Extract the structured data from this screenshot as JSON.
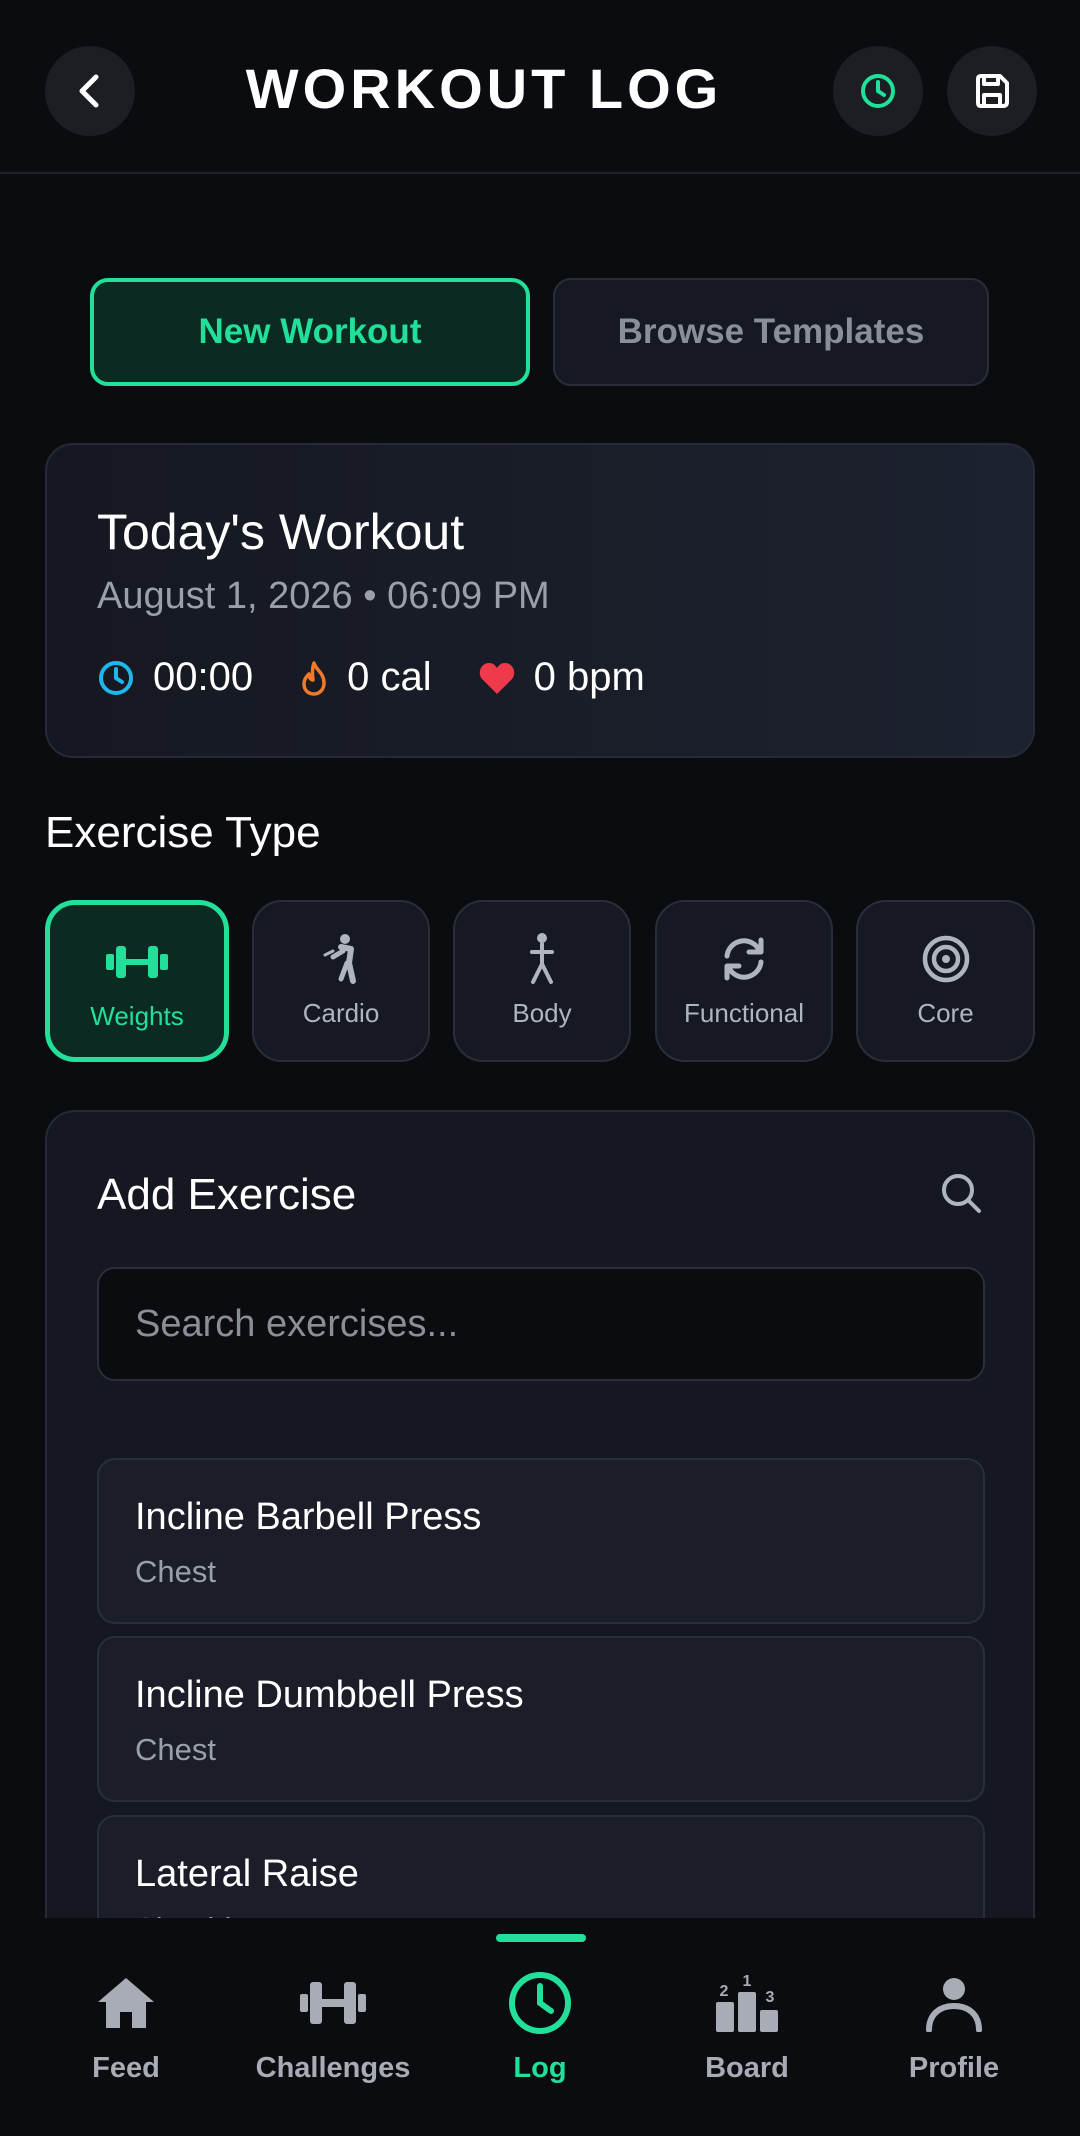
{
  "header": {
    "title": "WORKOUT LOG"
  },
  "mode_buttons": {
    "new_workout": "New Workout",
    "browse_templates": "Browse Templates"
  },
  "today": {
    "title": "Today's Workout",
    "date": "August 1, 2026 • 06:09 PM",
    "duration": "00:00",
    "calories": "0 cal",
    "heart_rate": "0 bpm"
  },
  "exercise_type": {
    "label": "Exercise Type",
    "types": [
      {
        "label": "Weights",
        "icon": "dumbbell-icon",
        "active": true
      },
      {
        "label": "Cardio",
        "icon": "running-icon",
        "active": false
      },
      {
        "label": "Body",
        "icon": "body-icon",
        "active": false
      },
      {
        "label": "Functional",
        "icon": "refresh-icon",
        "active": false
      },
      {
        "label": "Core",
        "icon": "target-icon",
        "active": false
      }
    ]
  },
  "add_exercise": {
    "title": "Add Exercise",
    "search_placeholder": "Search exercises...",
    "items": [
      {
        "name": "Incline Barbell Press",
        "group": "Chest"
      },
      {
        "name": "Incline Dumbbell Press",
        "group": "Chest"
      },
      {
        "name": "Lateral Raise",
        "group": "Shoulders"
      }
    ]
  },
  "nav": {
    "items": [
      {
        "label": "Feed",
        "icon": "home-icon"
      },
      {
        "label": "Challenges",
        "icon": "dumbbell-icon"
      },
      {
        "label": "Log",
        "icon": "clock-icon",
        "active": true
      },
      {
        "label": "Board",
        "icon": "podium-icon"
      },
      {
        "label": "Profile",
        "icon": "person-icon"
      }
    ]
  },
  "colors": {
    "accent": "#22e09a",
    "background": "#0b0c10",
    "card": "#151821",
    "clock_icon": "#1fb6ea",
    "fire_icon": "#f07a2a",
    "heart_icon": "#ee3a4a"
  }
}
